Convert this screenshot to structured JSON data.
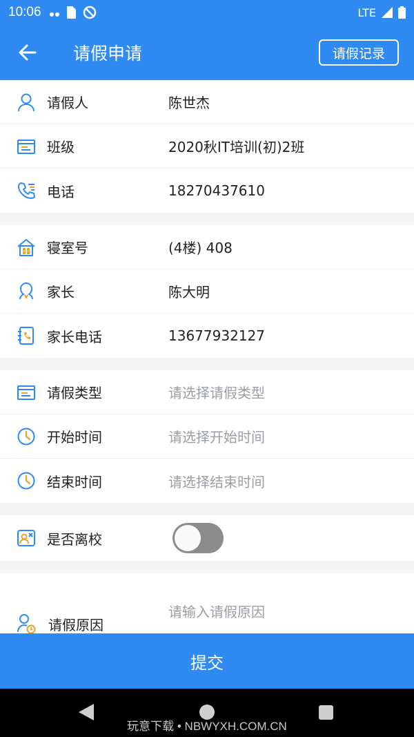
{
  "status_bar": {
    "time": "10:06",
    "network": "LTE"
  },
  "app_bar": {
    "title": "请假申请",
    "record_button": "请假记录"
  },
  "groups": [
    [
      {
        "icon": "person-icon",
        "label": "请假人",
        "value": "陈世杰"
      },
      {
        "icon": "class-icon",
        "label": "班级",
        "value": "2020秋IT培训(初)2班"
      },
      {
        "icon": "phone-icon",
        "label": "电话",
        "value": "18270437610"
      }
    ],
    [
      {
        "icon": "dorm-icon",
        "label": "寝室号",
        "value": "(4楼) 408"
      },
      {
        "icon": "parent-icon",
        "label": "家长",
        "value": "陈大明"
      },
      {
        "icon": "contact-book-icon",
        "label": "家长电话",
        "value": "13677932127"
      }
    ],
    [
      {
        "icon": "type-icon",
        "label": "请假类型",
        "placeholder": "请选择请假类型"
      },
      {
        "icon": "clock-icon",
        "label": "开始时间",
        "placeholder": "请选择开始时间"
      },
      {
        "icon": "clock-icon",
        "label": "结束时间",
        "placeholder": "请选择结束时间"
      }
    ]
  ],
  "leave_school": {
    "label": "是否离校",
    "enabled": false
  },
  "reason": {
    "label": "请假原因",
    "placeholder": "请输入请假原因"
  },
  "submit": {
    "label": "提交"
  },
  "watermark": "玩意下载 • NBWYXH.COM.CN"
}
